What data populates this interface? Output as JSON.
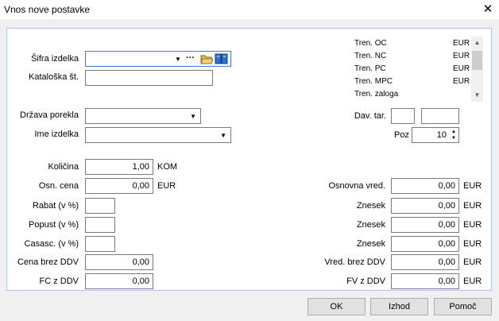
{
  "window": {
    "title": "Vnos nove postavke",
    "close_glyph": "✕"
  },
  "left": {
    "sifra_label": "Šifra izdelka",
    "sifra_value": "",
    "sifra_more": "···",
    "kataloska_label": "Kataloška št.",
    "drzava_label": "Država porekla",
    "ime_label": "Ime izdelka",
    "kolicina_label": "Količina",
    "kolicina_value": "1,00",
    "kolicina_unit": "KOM",
    "osn_cena_label": "Osn. cena",
    "osn_cena_value": "0,00",
    "osn_cena_unit": "EUR",
    "rabat_label": "Rabat (v %)",
    "popust_label": "Popust (v %)",
    "casasc_label": "Casasc. (v %)",
    "cena_brez_label": "Cena brez DDV",
    "cena_brez_value": "0,00",
    "fc_label": "FC z DDV",
    "fc_value": "0,00"
  },
  "info": [
    {
      "label": "Tren. OC",
      "value": "EUR"
    },
    {
      "label": "Tren. NC",
      "value": "EUR"
    },
    {
      "label": "Tren. PC",
      "value": "EUR"
    },
    {
      "label": "Tren. MPC",
      "value": "EUR"
    },
    {
      "label": "Tren. zaloga",
      "value": ""
    }
  ],
  "right": {
    "dav_label": "Dav. tar.",
    "poz_label": "Poz",
    "poz_value": "10",
    "osnovna_label": "Osnovna vred.",
    "osnovna_value": "0,00",
    "znesek1_label": "Znesek",
    "znesek1_value": "0,00",
    "znesek2_label": "Znesek",
    "znesek2_value": "0,00",
    "znesek3_label": "Znesek",
    "znesek3_value": "0,00",
    "vred_brez_label": "Vred. brez DDV",
    "vred_brez_value": "0,00",
    "fv_label": "FV z DDV",
    "fv_value": "0,00",
    "unit": "EUR"
  },
  "buttons": {
    "ok": "OK",
    "izhod": "Izhod",
    "pomoc": "Pomoč"
  },
  "colors": {
    "accent": "#3d7bd9",
    "panel_border": "#a9c6e8"
  }
}
